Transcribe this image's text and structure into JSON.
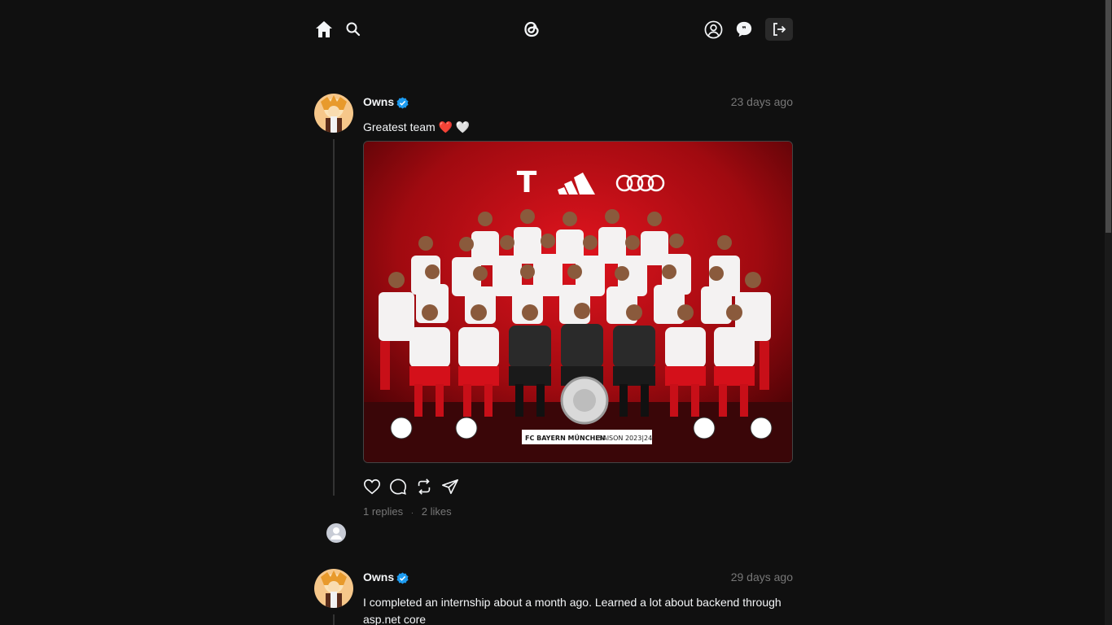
{
  "nav": {
    "home_icon": "home-icon",
    "search_icon": "search-icon",
    "logo_icon": "threads-logo-icon",
    "profile_icon": "user-circle-icon",
    "messages_icon": "chat-icon",
    "logout_icon": "logout-icon"
  },
  "posts": [
    {
      "username": "Owns",
      "verified": true,
      "time": "23 days ago",
      "text": "Greatest team ❤️ 🤍",
      "image_caption_line1": "FC BAYERN MÜNCHEN",
      "image_caption_line2": "SAISON 2023|24",
      "replies_label": "1 replies",
      "likes_label": "2 likes",
      "separator": "·"
    },
    {
      "username": "Owns",
      "verified": true,
      "time": "29 days ago",
      "text": "I completed an internship about a month ago. Learned a lot about backend through asp.net core"
    }
  ],
  "colors": {
    "background": "#101010",
    "text": "#f3f5f7",
    "muted": "#777777",
    "verified": "#1d9bf0",
    "heart": "#e0245e"
  }
}
